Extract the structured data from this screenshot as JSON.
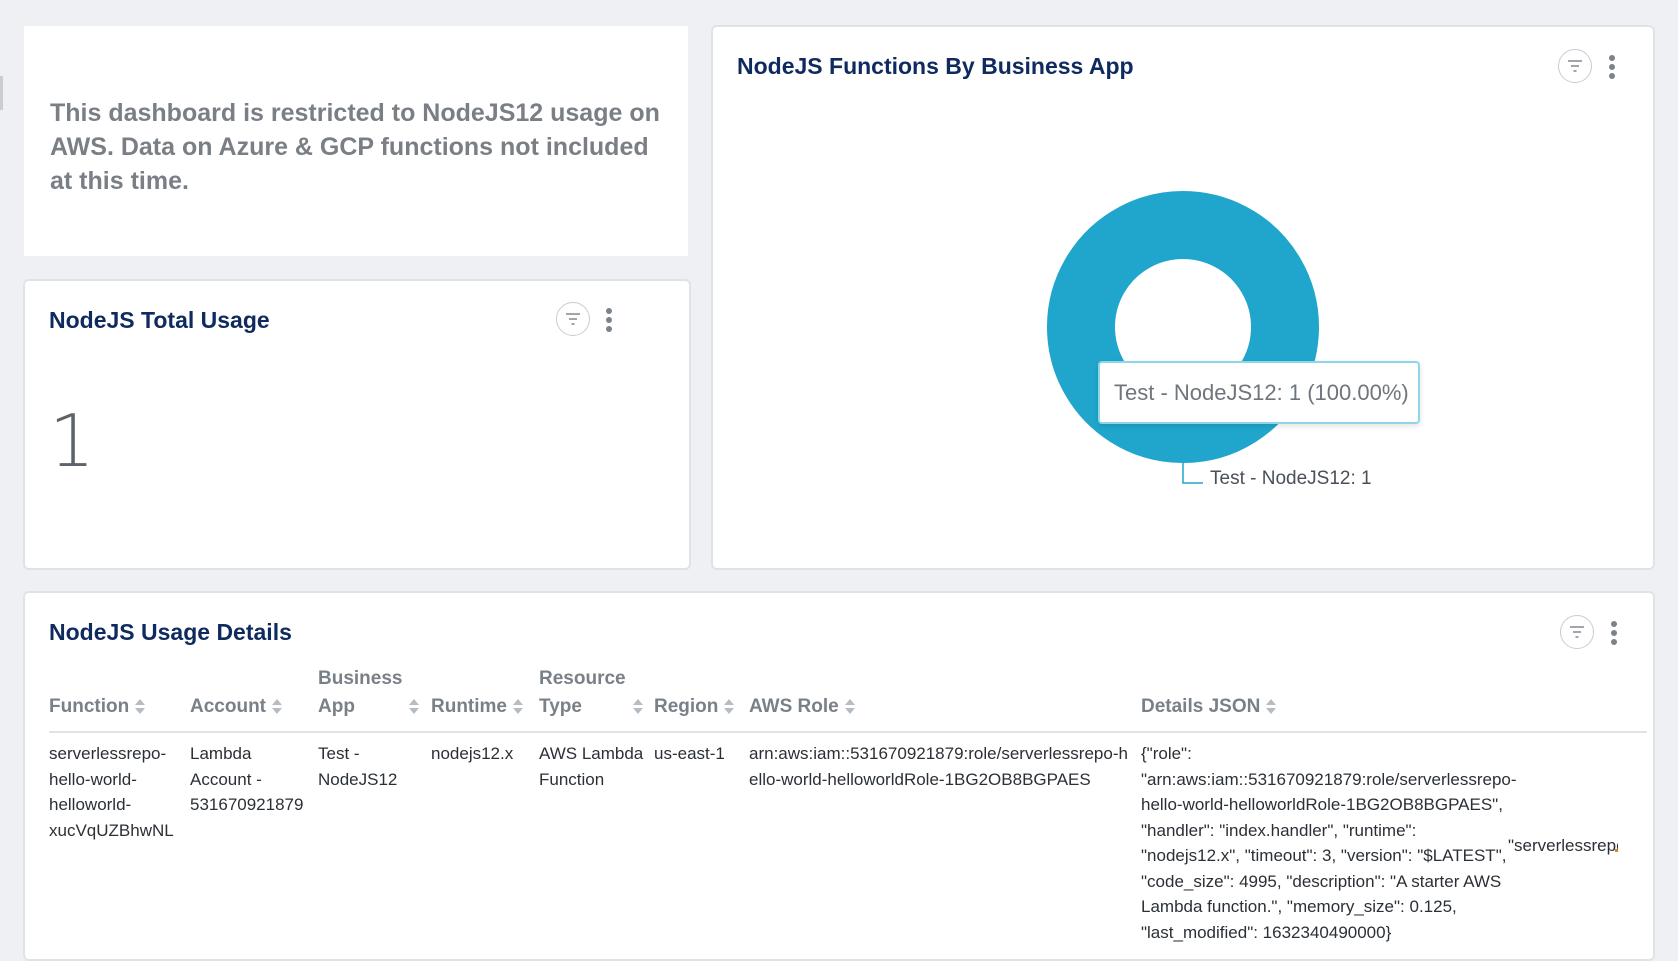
{
  "notice": {
    "text": "This dashboard is restricted to NodeJS12 usage on AWS. Data on Azure & GCP functions not included at this time."
  },
  "usage_panel": {
    "title": "NodeJS Total Usage",
    "value": "1"
  },
  "pie_panel": {
    "title": "NodeJS Functions By Business App",
    "tooltip": "Test - NodeJS12: 1 (100.00%)",
    "slice_label": "Test - NodeJS12: 1"
  },
  "chart_data": {
    "type": "pie",
    "donut": true,
    "title": "NodeJS Functions By Business App",
    "slices": [
      {
        "label": "Test - NodeJS12",
        "value": 1,
        "percent": 100.0,
        "color": "#20a6cc"
      }
    ]
  },
  "details_panel": {
    "title": "NodeJS Usage Details",
    "columns": [
      "Function",
      "Account",
      "Business App",
      "Runtime",
      "Resource Type",
      "Region",
      "AWS Role",
      "Details JSON"
    ],
    "rows": [
      {
        "function": "serverlessrepo-hello-world-helloworld-xucVqUZBhwNL",
        "account": "Lambda Account - 531670921879",
        "business_app": "Test - NodeJS12",
        "runtime": "nodejs12.x",
        "resource_type": "AWS Lambda Function",
        "region": "us-east-1",
        "aws_role": "arn:aws:iam::531670921879:role/serverlessrepo-hello-world-helloworldRole-1BG2OB8BGPAES",
        "details_json": "{\"role\": \"arn:aws:iam::531670921879:role/serverlessrepo-hello-world-helloworldRole-1BG2OB8BGPAES\", \"handler\": \"index.handler\", \"runtime\": \"nodejs12.x\", \"timeout\": 3, \"version\": \"$LATEST\", \"code_size\": 4995, \"description\": \"A starter AWS Lambda function.\", \"memory_size\": 0.125, \"last_modified\": 1632340490000}",
        "overflow": "\"serverlessrepo"
      }
    ]
  },
  "colors": {
    "title": "#0f2a5f",
    "link": "#1a6fe0",
    "donut": "#20a6cc",
    "tooltip_border": "#8fd6ea"
  },
  "icons": [
    "filter-icon",
    "more-vertical-icon",
    "sort-icon"
  ]
}
